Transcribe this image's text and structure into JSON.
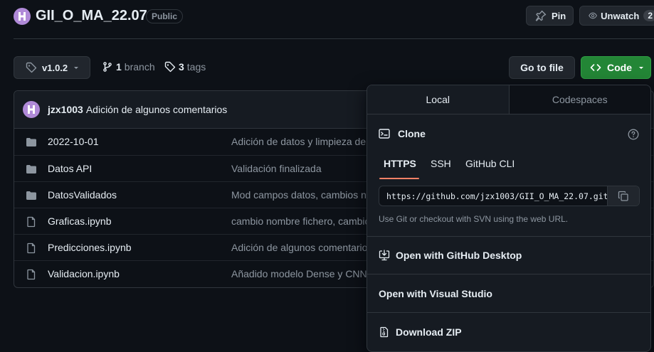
{
  "repo": {
    "name": "GII_O_MA_22.07",
    "visibility": "Public"
  },
  "actions": {
    "pin": "Pin",
    "watch": "Unwatch",
    "watch_count": "2"
  },
  "toolbar": {
    "branch_select": "v1.0.2",
    "branch_count": "1",
    "branch_label": "branch",
    "tag_count": "3",
    "tag_label": "tags",
    "go_to_file": "Go to file",
    "code": "Code"
  },
  "commit": {
    "author": "jzx1003",
    "message": "Adición de algunos comentarios"
  },
  "files": [
    {
      "name": "2022-10-01",
      "type": "folder",
      "message": "Adición de datos y limpieza de"
    },
    {
      "name": "Datos API",
      "type": "folder",
      "message": "Validación finalizada"
    },
    {
      "name": "DatosValidados",
      "type": "folder",
      "message": "Mod campos datos, cambios n"
    },
    {
      "name": "Graficas.ipynb",
      "type": "file",
      "message": "cambio nombre fichero, cambio"
    },
    {
      "name": "Predicciones.ipynb",
      "type": "file",
      "message": "Adición de algunos comentario"
    },
    {
      "name": "Validacion.ipynb",
      "type": "file",
      "message": "Añadido modelo Dense y CNN"
    }
  ],
  "code_dropdown": {
    "tabs": [
      "Local",
      "Codespaces"
    ],
    "clone_title": "Clone",
    "clone_tabs": [
      "HTTPS",
      "SSH",
      "GitHub CLI"
    ],
    "clone_url": "https://github.com/jzx1003/GII_O_MA_22.07.git",
    "clone_hint": "Use Git or checkout with SVN using the web URL.",
    "open_desktop": "Open with GitHub Desktop",
    "open_vs": "Open with Visual Studio",
    "download_zip": "Download ZIP"
  },
  "colors": {
    "code_button": "#238636",
    "underline": "#f78166",
    "avatar": "#b08ad8"
  },
  "icons": [
    "avatar-logo",
    "pin-icon",
    "eye-icon",
    "tag-icon",
    "branch-icon",
    "caret-down-icon",
    "code-icon",
    "folder-icon",
    "file-icon",
    "terminal-icon",
    "help-icon",
    "copy-icon",
    "desktop-download-icon",
    "file-zip-icon"
  ]
}
